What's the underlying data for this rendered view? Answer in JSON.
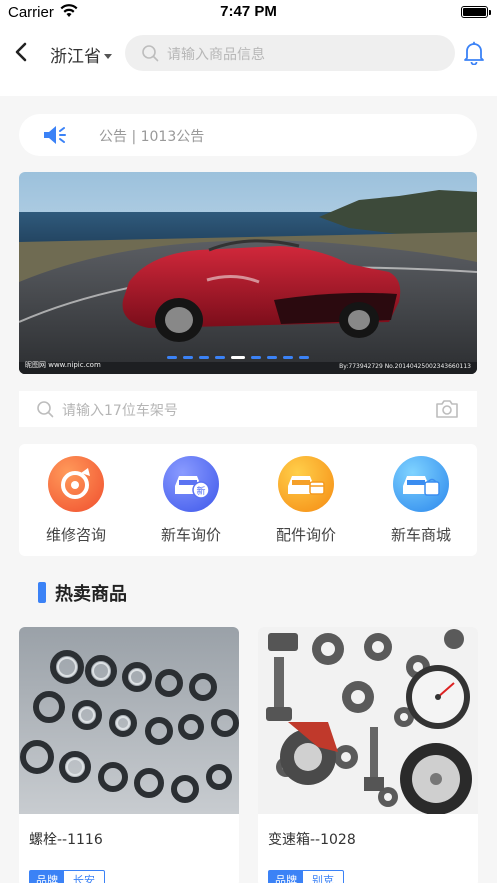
{
  "status_bar": {
    "carrier": "Carrier",
    "time": "7:47 PM"
  },
  "nav": {
    "province": "浙江省",
    "search_placeholder": "请输入商品信息"
  },
  "notice": {
    "text": "公告 | 1013公告"
  },
  "banner": {
    "watermark_left": "昵图网 www.nipic.com",
    "watermark_right": "By:773942729 No.20140425002343660113",
    "slide_count": 9,
    "active_slide": 4
  },
  "vin_search": {
    "placeholder": "请输入17位车架号"
  },
  "services": [
    {
      "label": "维修咨询",
      "icon": "wrench-icon",
      "color": "#f5623a"
    },
    {
      "label": "新车询价",
      "icon": "new-car-icon",
      "color": "#4f6cf5"
    },
    {
      "label": "配件询价",
      "icon": "parts-car-icon",
      "color": "#f59a1f"
    },
    {
      "label": "新车商城",
      "icon": "mall-car-icon",
      "color": "#3b8df0"
    }
  ],
  "section": {
    "title": "热卖商品"
  },
  "products": [
    {
      "name": "螺栓--1116",
      "tag_key": "品牌",
      "tag_value": "长安"
    },
    {
      "name": "变速箱--1028",
      "tag_key": "品牌",
      "tag_value": "别克"
    }
  ],
  "colors": {
    "accent": "#3b82f6",
    "background": "#f6f6f6"
  }
}
